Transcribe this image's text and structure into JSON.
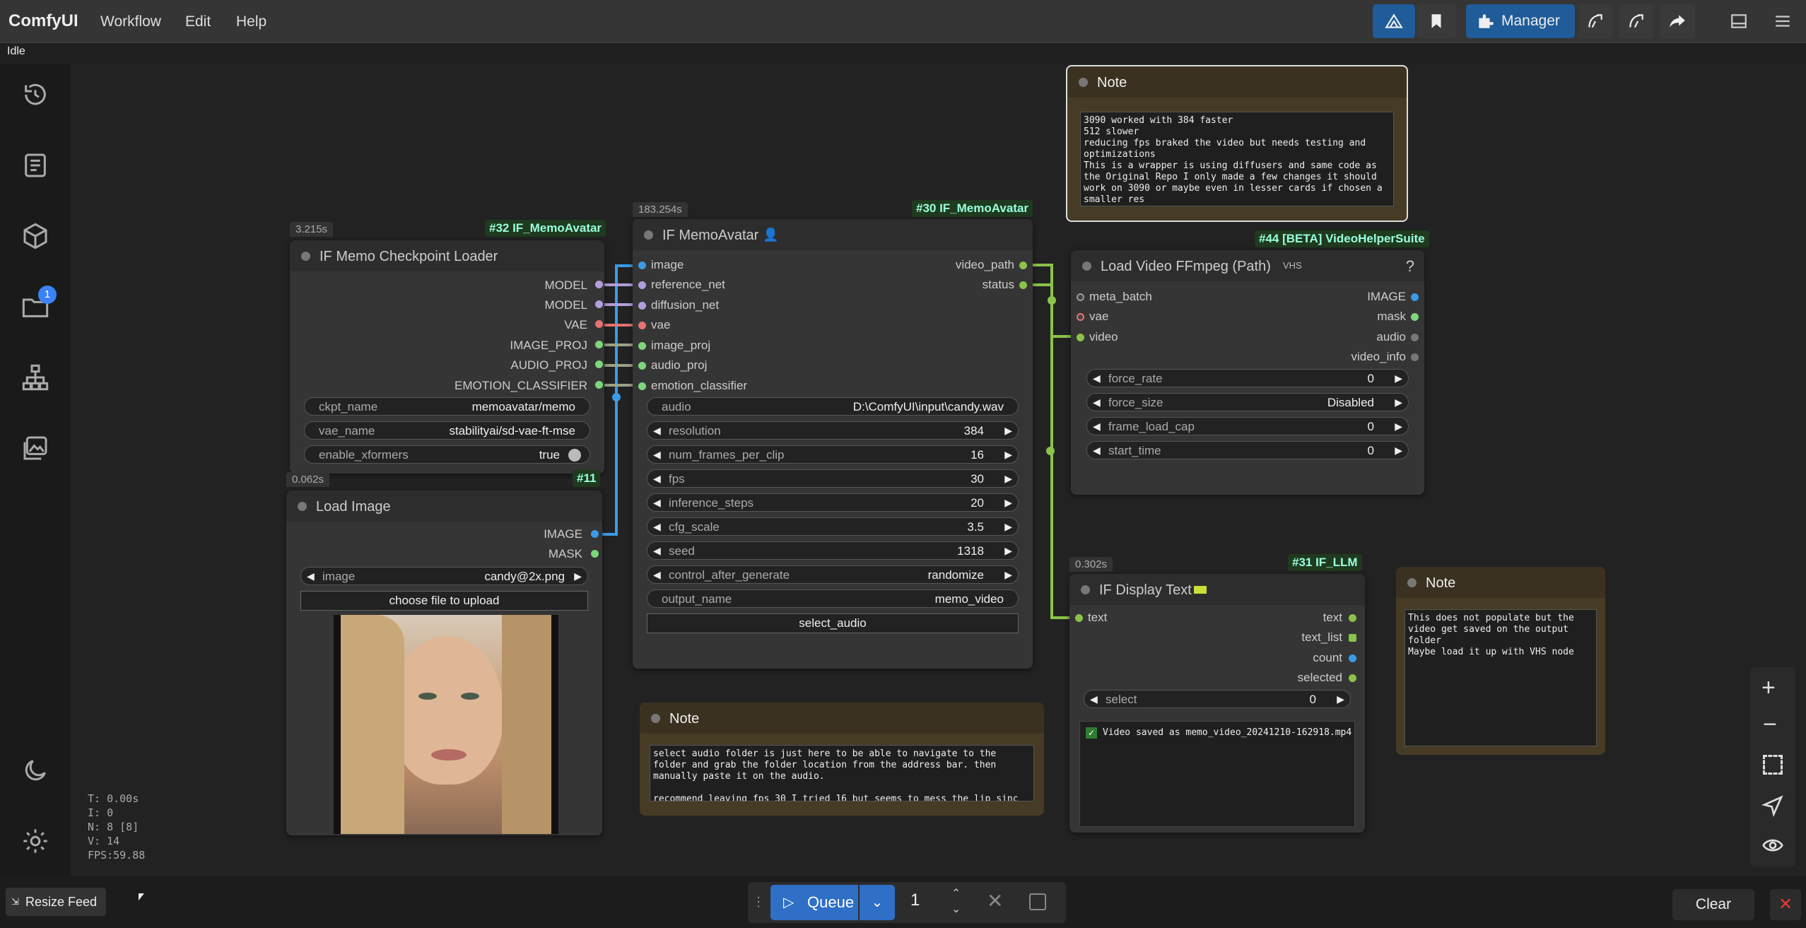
{
  "app": {
    "title": "ComfyUI",
    "status": "Idle"
  },
  "menu": [
    "Workflow",
    "Edit",
    "Help"
  ],
  "toolbar": {
    "manager_label": "Manager",
    "icons": [
      "mountain-icon",
      "bookmark-icon",
      "puzzle-icon",
      "sync-icon",
      "sync-alt-icon",
      "share-icon",
      "panel-icon",
      "hamburger-icon"
    ]
  },
  "sidebar": {
    "badge": "1",
    "icons": [
      "history-icon",
      "document-icon",
      "cube-icon",
      "folder-icon",
      "hierarchy-icon",
      "gallery-icon",
      "moon-icon",
      "gear-icon"
    ]
  },
  "stats": [
    "T: 0.00s",
    "I: 0",
    "N: 8 [8]",
    "V: 14",
    "FPS:59.88"
  ],
  "nodes": {
    "checkpoint": {
      "time": "3.215s",
      "id": "#32 IF_MemoAvatar",
      "title": "IF Memo Checkpoint Loader",
      "outputs": [
        "MODEL",
        "MODEL",
        "VAE",
        "IMAGE_PROJ",
        "AUDIO_PROJ",
        "EMOTION_CLASSIFIER"
      ],
      "widgets": [
        {
          "label": "ckpt_name",
          "value": "memoavatar/memo"
        },
        {
          "label": "vae_name",
          "value": "stabilityai/sd-vae-ft-mse"
        },
        {
          "label": "enable_xformers",
          "value": "true"
        }
      ]
    },
    "loadimage": {
      "time": "0.062s",
      "id": "#11",
      "title": "Load Image",
      "outputs": [
        "IMAGE",
        "MASK"
      ],
      "widget": {
        "label": "image",
        "value": "candy@2x.png"
      },
      "button": "choose file to upload"
    },
    "memo": {
      "time": "183.254s",
      "id": "#30 IF_MemoAvatar",
      "title": "IF MemoAvatar",
      "inputs": [
        "image",
        "reference_net",
        "diffusion_net",
        "vae",
        "image_proj",
        "audio_proj",
        "emotion_classifier"
      ],
      "outputs": [
        "video_path",
        "status"
      ],
      "widgets": [
        {
          "label": "audio",
          "value": "D:\\ComfyUI\\input\\candy.wav"
        },
        {
          "label": "resolution",
          "value": "384"
        },
        {
          "label": "num_frames_per_clip",
          "value": "16"
        },
        {
          "label": "fps",
          "value": "30"
        },
        {
          "label": "inference_steps",
          "value": "20"
        },
        {
          "label": "cfg_scale",
          "value": "3.5"
        },
        {
          "label": "seed",
          "value": "1318"
        },
        {
          "label": "control_after_generate",
          "value": "randomize"
        },
        {
          "label": "output_name",
          "value": "memo_video"
        }
      ],
      "button": "select_audio"
    },
    "loadvideo": {
      "id": "#44 [BETA] VideoHelperSuite",
      "title": "Load Video FFmpeg (Path)",
      "badge": "VHS",
      "inputs": [
        "meta_batch",
        "vae",
        "video"
      ],
      "outputs": [
        "IMAGE",
        "mask",
        "audio",
        "video_info"
      ],
      "widgets": [
        {
          "label": "force_rate",
          "value": "0"
        },
        {
          "label": "force_size",
          "value": "Disabled"
        },
        {
          "label": "frame_load_cap",
          "value": "0"
        },
        {
          "label": "start_time",
          "value": "0"
        }
      ]
    },
    "display": {
      "time": "0.302s",
      "id": "#31 IF_LLM",
      "title": "IF Display Text",
      "inputs": [
        "text"
      ],
      "outputs": [
        "text",
        "text_list",
        "count",
        "selected"
      ],
      "widget": {
        "label": "select",
        "value": "0"
      },
      "output_text": "Video saved as memo_video_20241210-162918.mp4"
    }
  },
  "notes": [
    {
      "title": "Note",
      "text": "3090 worked with 384 faster\n512 slower\nreducing fps braked the video but needs testing and optimizations\nThis is a wrapper is using diffusers and same code as the Original Repo I only made a few changes it should work on 3090 or maybe even in lesser cards if chosen a smaller res"
    },
    {
      "title": "Note",
      "text": "select audio folder is just here to be able to navigate to the folder and grab the folder location from the address bar. then manually paste it on the audio.\n\nrecommend leaving fps 30 I tried 16 but seems to mess the lip sinc"
    },
    {
      "title": "Note",
      "text": "This does not populate but the video get saved on the output folder\nMaybe load it up with VHS node"
    }
  ],
  "bottom": {
    "resize_feed": "Resize Feed",
    "queue": "Queue",
    "count": "1",
    "clear": "Clear"
  }
}
